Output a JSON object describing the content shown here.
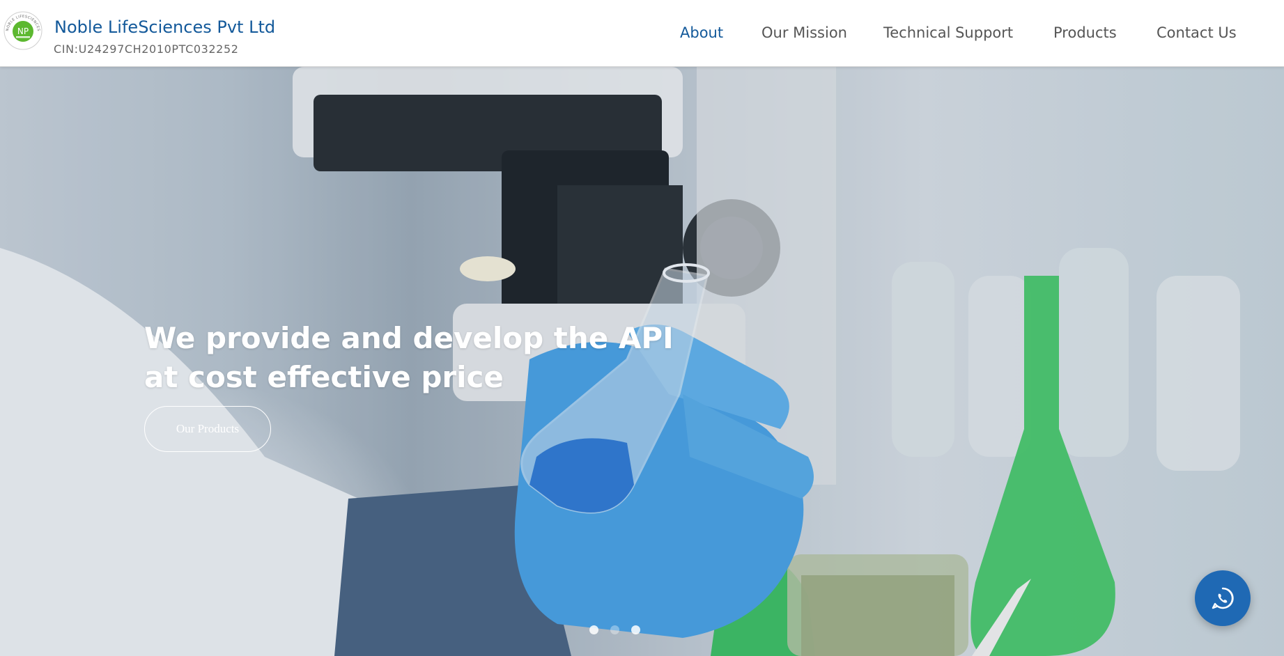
{
  "brand": {
    "name": "Noble LifeSciences Pvt Ltd",
    "cin": "CIN:U24297CH2010PTC032252",
    "logo_ring_text": "NOBLE LIFESCIENCES PVT LTD",
    "logo_initials": "NP"
  },
  "nav": {
    "items": [
      {
        "label": "About",
        "active": true
      },
      {
        "label": "Our Mission",
        "active": false
      },
      {
        "label": "Technical Support",
        "active": false
      },
      {
        "label": "Products",
        "active": false
      },
      {
        "label": "Contact Us",
        "active": false
      }
    ]
  },
  "hero": {
    "heading_line1": "We provide and develop the API",
    "heading_line2": "at cost effective price",
    "cta_label": "Our Products",
    "carousel": {
      "slides": 3,
      "active_index": 1
    }
  },
  "floating": {
    "whatsapp_icon": "whatsapp-icon"
  },
  "colors": {
    "brand_blue": "#13599a",
    "nav_text": "#555555",
    "logo_green": "#5cb82f",
    "whatsapp_bg": "#1f69b4"
  }
}
